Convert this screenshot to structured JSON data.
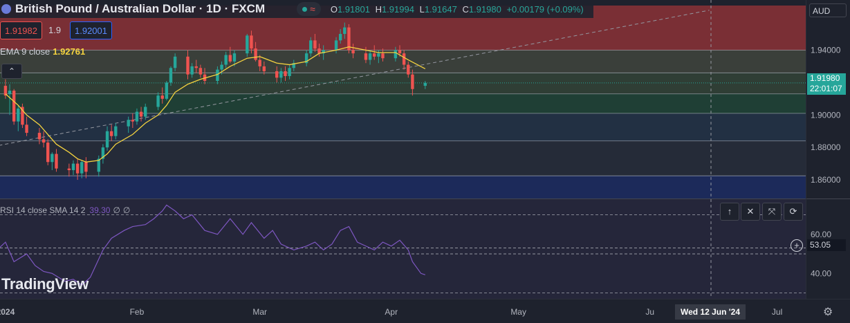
{
  "header": {
    "title": "British Pound / Australian Dollar · 1D · FXCM",
    "ohlc": [
      {
        "label": "O",
        "value": "1.91801"
      },
      {
        "label": "H",
        "value": "1.91994"
      },
      {
        "label": "L",
        "value": "1.91647"
      },
      {
        "label": "C",
        "value": "1.91980"
      },
      {
        "label": "",
        "value": "+0.00179 (+0.09%)"
      }
    ],
    "wave_icon": "≈"
  },
  "trade": {
    "sell": "1.91982",
    "spread": "1.9",
    "buy": "1.92001"
  },
  "ema": {
    "label": "EMA 9 close",
    "value": "1.92761"
  },
  "collapse_icon": "⌃",
  "rsi": {
    "label": "RSI 14 close SMA 14 2",
    "value": "39.30",
    "extra1": "∅",
    "extra2": "∅"
  },
  "pane_buttons": [
    "↑",
    "✕",
    "⤧",
    "⟳"
  ],
  "logo": "TradingView",
  "axis": {
    "currency": "AUD",
    "price_label": "1.91980",
    "countdown": "22:01:07",
    "rsi_label": "53.05",
    "crosshair_date": "Wed 12 Jun '24"
  },
  "colors": {
    "up": "#26a69a",
    "down": "#ef5350",
    "ema": "#f5d33f",
    "rsi": "#7e57c2",
    "bg": "#1e222d"
  },
  "chart_data": {
    "type": "candlestick",
    "title": "British Pound / Australian Dollar · 1D · FXCM",
    "y_ticks": [
      "1.86000",
      "1.88000",
      "1.90000",
      "1.94000"
    ],
    "y_tick_values": [
      1.86,
      1.88,
      1.9,
      1.94
    ],
    "ylim": [
      1.8485,
      1.9675
    ],
    "x_ticks": [
      "2024",
      "Feb",
      "Mar",
      "Apr",
      "May",
      "Ju",
      "Jul"
    ],
    "x_tick_days": [
      0,
      31,
      60,
      91,
      121,
      152,
      182
    ],
    "zones": [
      {
        "from": 1.94,
        "to": 1.9675,
        "color": "#7a2f35"
      },
      {
        "from": 1.926,
        "to": 1.94,
        "color": "#3a3f3a"
      },
      {
        "from": 1.913,
        "to": 1.926,
        "color": "#2f3e35"
      },
      {
        "from": 1.901,
        "to": 1.913,
        "color": "#1f3f35"
      },
      {
        "from": 1.884,
        "to": 1.901,
        "color": "#223043"
      },
      {
        "from": 1.8625,
        "to": 1.884,
        "color": "#252b38"
      },
      {
        "from": 1.8485,
        "to": 1.8625,
        "color": "#1c2a5a"
      }
    ],
    "levels": [
      1.94,
      1.926,
      1.913,
      1.901,
      1.884,
      1.8625
    ],
    "current_price": 1.9198,
    "trendline": {
      "start": [
        -3,
        1.8805
      ],
      "end": [
        166,
        1.9646
      ]
    },
    "candles": [
      {
        "d": -2,
        "o": 1.915,
        "h": 1.92,
        "l": 1.908,
        "c": 1.918
      },
      {
        "d": 0,
        "o": 1.918,
        "h": 1.922,
        "l": 1.91,
        "c": 1.912
      },
      {
        "d": 1,
        "o": 1.913,
        "h": 1.919,
        "l": 1.9,
        "c": 1.915
      },
      {
        "d": 2,
        "o": 1.915,
        "h": 1.916,
        "l": 1.894,
        "c": 1.896
      },
      {
        "d": 3,
        "o": 1.896,
        "h": 1.906,
        "l": 1.89,
        "c": 1.904
      },
      {
        "d": 4,
        "o": 1.905,
        "h": 1.907,
        "l": 1.892,
        "c": 1.894
      },
      {
        "d": 5,
        "o": 1.894,
        "h": 1.899,
        "l": 1.887,
        "c": 1.889
      },
      {
        "d": 8,
        "o": 1.889,
        "h": 1.892,
        "l": 1.882,
        "c": 1.885
      },
      {
        "d": 9,
        "o": 1.885,
        "h": 1.89,
        "l": 1.88,
        "c": 1.883
      },
      {
        "d": 10,
        "o": 1.883,
        "h": 1.885,
        "l": 1.869,
        "c": 1.871
      },
      {
        "d": 11,
        "o": 1.871,
        "h": 1.877,
        "l": 1.866,
        "c": 1.876
      },
      {
        "d": 12,
        "o": 1.876,
        "h": 1.879,
        "l": 1.865,
        "c": 1.867
      },
      {
        "d": 15,
        "o": 1.867,
        "h": 1.87,
        "l": 1.862,
        "c": 1.866
      },
      {
        "d": 16,
        "o": 1.866,
        "h": 1.872,
        "l": 1.863,
        "c": 1.87
      },
      {
        "d": 17,
        "o": 1.87,
        "h": 1.873,
        "l": 1.86,
        "c": 1.864
      },
      {
        "d": 18,
        "o": 1.864,
        "h": 1.872,
        "l": 1.861,
        "c": 1.871
      },
      {
        "d": 19,
        "o": 1.871,
        "h": 1.874,
        "l": 1.861,
        "c": 1.865
      },
      {
        "d": 22,
        "o": 1.865,
        "h": 1.875,
        "l": 1.862,
        "c": 1.873
      },
      {
        "d": 23,
        "o": 1.873,
        "h": 1.882,
        "l": 1.87,
        "c": 1.88
      },
      {
        "d": 24,
        "o": 1.88,
        "h": 1.893,
        "l": 1.878,
        "c": 1.89
      },
      {
        "d": 25,
        "o": 1.89,
        "h": 1.894,
        "l": 1.884,
        "c": 1.887
      },
      {
        "d": 26,
        "o": 1.887,
        "h": 1.895,
        "l": 1.885,
        "c": 1.893
      },
      {
        "d": 29,
        "o": 1.893,
        "h": 1.899,
        "l": 1.889,
        "c": 1.897
      },
      {
        "d": 30,
        "o": 1.897,
        "h": 1.901,
        "l": 1.892,
        "c": 1.896
      },
      {
        "d": 31,
        "o": 1.896,
        "h": 1.904,
        "l": 1.894,
        "c": 1.902
      },
      {
        "d": 32,
        "o": 1.902,
        "h": 1.905,
        "l": 1.896,
        "c": 1.899
      },
      {
        "d": 33,
        "o": 1.899,
        "h": 1.907,
        "l": 1.897,
        "c": 1.905
      },
      {
        "d": 36,
        "o": 1.905,
        "h": 1.914,
        "l": 1.903,
        "c": 1.912
      },
      {
        "d": 37,
        "o": 1.912,
        "h": 1.917,
        "l": 1.907,
        "c": 1.91
      },
      {
        "d": 38,
        "o": 1.91,
        "h": 1.921,
        "l": 1.909,
        "c": 1.92
      },
      {
        "d": 39,
        "o": 1.92,
        "h": 1.93,
        "l": 1.918,
        "c": 1.929
      },
      {
        "d": 40,
        "o": 1.929,
        "h": 1.938,
        "l": 1.927,
        "c": 1.936
      },
      {
        "d": 43,
        "o": 1.936,
        "h": 1.94,
        "l": 1.922,
        "c": 1.925
      },
      {
        "d": 44,
        "o": 1.925,
        "h": 1.932,
        "l": 1.923,
        "c": 1.93
      },
      {
        "d": 45,
        "o": 1.93,
        "h": 1.934,
        "l": 1.926,
        "c": 1.929
      },
      {
        "d": 46,
        "o": 1.929,
        "h": 1.931,
        "l": 1.923,
        "c": 1.925
      },
      {
        "d": 47,
        "o": 1.925,
        "h": 1.929,
        "l": 1.919,
        "c": 1.921
      },
      {
        "d": 50,
        "o": 1.921,
        "h": 1.93,
        "l": 1.919,
        "c": 1.928
      },
      {
        "d": 51,
        "o": 1.928,
        "h": 1.933,
        "l": 1.925,
        "c": 1.931
      },
      {
        "d": 52,
        "o": 1.931,
        "h": 1.939,
        "l": 1.929,
        "c": 1.937
      },
      {
        "d": 53,
        "o": 1.937,
        "h": 1.942,
        "l": 1.932,
        "c": 1.933
      },
      {
        "d": 54,
        "o": 1.933,
        "h": 1.94,
        "l": 1.93,
        "c": 1.938
      },
      {
        "d": 57,
        "o": 1.938,
        "h": 1.95,
        "l": 1.936,
        "c": 1.949
      },
      {
        "d": 58,
        "o": 1.949,
        "h": 1.952,
        "l": 1.938,
        "c": 1.941
      },
      {
        "d": 59,
        "o": 1.941,
        "h": 1.945,
        "l": 1.933,
        "c": 1.934
      },
      {
        "d": 60,
        "o": 1.934,
        "h": 1.937,
        "l": 1.927,
        "c": 1.93
      },
      {
        "d": 61,
        "o": 1.93,
        "h": 1.933,
        "l": 1.925,
        "c": 1.927
      },
      {
        "d": 64,
        "o": 1.927,
        "h": 1.93,
        "l": 1.92,
        "c": 1.923
      },
      {
        "d": 65,
        "o": 1.923,
        "h": 1.929,
        "l": 1.92,
        "c": 1.927
      },
      {
        "d": 66,
        "o": 1.927,
        "h": 1.93,
        "l": 1.921,
        "c": 1.924
      },
      {
        "d": 67,
        "o": 1.924,
        "h": 1.931,
        "l": 1.922,
        "c": 1.929
      },
      {
        "d": 68,
        "o": 1.929,
        "h": 1.934,
        "l": 1.927,
        "c": 1.932
      },
      {
        "d": 71,
        "o": 1.932,
        "h": 1.94,
        "l": 1.93,
        "c": 1.938
      },
      {
        "d": 72,
        "o": 1.938,
        "h": 1.948,
        "l": 1.936,
        "c": 1.946
      },
      {
        "d": 73,
        "o": 1.946,
        "h": 1.95,
        "l": 1.939,
        "c": 1.941
      },
      {
        "d": 74,
        "o": 1.941,
        "h": 1.944,
        "l": 1.936,
        "c": 1.938
      },
      {
        "d": 75,
        "o": 1.938,
        "h": 1.943,
        "l": 1.934,
        "c": 1.94
      },
      {
        "d": 78,
        "o": 1.94,
        "h": 1.948,
        "l": 1.938,
        "c": 1.946
      },
      {
        "d": 79,
        "o": 1.946,
        "h": 1.953,
        "l": 1.944,
        "c": 1.95
      },
      {
        "d": 80,
        "o": 1.95,
        "h": 1.957,
        "l": 1.947,
        "c": 1.954
      },
      {
        "d": 81,
        "o": 1.954,
        "h": 1.956,
        "l": 1.938,
        "c": 1.94
      },
      {
        "d": 82,
        "o": 1.94,
        "h": 1.944,
        "l": 1.935,
        "c": 1.938
      },
      {
        "d": 85,
        "o": 1.938,
        "h": 1.942,
        "l": 1.932,
        "c": 1.934
      },
      {
        "d": 86,
        "o": 1.934,
        "h": 1.94,
        "l": 1.931,
        "c": 1.938
      },
      {
        "d": 87,
        "o": 1.938,
        "h": 1.943,
        "l": 1.934,
        "c": 1.936
      },
      {
        "d": 88,
        "o": 1.936,
        "h": 1.94,
        "l": 1.932,
        "c": 1.938
      },
      {
        "d": 89,
        "o": 1.938,
        "h": 1.941,
        "l": 1.933,
        "c": 1.935
      },
      {
        "d": 92,
        "o": 1.935,
        "h": 1.942,
        "l": 1.933,
        "c": 1.94
      },
      {
        "d": 93,
        "o": 1.94,
        "h": 1.943,
        "l": 1.936,
        "c": 1.938
      },
      {
        "d": 94,
        "o": 1.938,
        "h": 1.94,
        "l": 1.928,
        "c": 1.931
      },
      {
        "d": 95,
        "o": 1.931,
        "h": 1.933,
        "l": 1.923,
        "c": 1.925
      },
      {
        "d": 96,
        "o": 1.925,
        "h": 1.928,
        "l": 1.912,
        "c": 1.916
      },
      {
        "d": 99,
        "o": 1.918,
        "h": 1.921,
        "l": 1.916,
        "c": 1.9198
      }
    ],
    "ema_series": [
      {
        "d": 0,
        "v": 1.913
      },
      {
        "d": 3,
        "v": 1.906
      },
      {
        "d": 5,
        "v": 1.9
      },
      {
        "d": 8,
        "v": 1.894
      },
      {
        "d": 10,
        "v": 1.888
      },
      {
        "d": 12,
        "v": 1.882
      },
      {
        "d": 15,
        "v": 1.877
      },
      {
        "d": 17,
        "v": 1.873
      },
      {
        "d": 19,
        "v": 1.871
      },
      {
        "d": 22,
        "v": 1.872
      },
      {
        "d": 24,
        "v": 1.876
      },
      {
        "d": 26,
        "v": 1.882
      },
      {
        "d": 30,
        "v": 1.888
      },
      {
        "d": 33,
        "v": 1.895
      },
      {
        "d": 36,
        "v": 1.9
      },
      {
        "d": 38,
        "v": 1.906
      },
      {
        "d": 40,
        "v": 1.914
      },
      {
        "d": 43,
        "v": 1.919
      },
      {
        "d": 46,
        "v": 1.922
      },
      {
        "d": 50,
        "v": 1.925
      },
      {
        "d": 53,
        "v": 1.93
      },
      {
        "d": 57,
        "v": 1.935
      },
      {
        "d": 60,
        "v": 1.936
      },
      {
        "d": 64,
        "v": 1.932
      },
      {
        "d": 67,
        "v": 1.931
      },
      {
        "d": 71,
        "v": 1.933
      },
      {
        "d": 74,
        "v": 1.938
      },
      {
        "d": 78,
        "v": 1.94
      },
      {
        "d": 81,
        "v": 1.942
      },
      {
        "d": 85,
        "v": 1.94
      },
      {
        "d": 88,
        "v": 1.9385
      },
      {
        "d": 92,
        "v": 1.9385
      },
      {
        "d": 95,
        "v": 1.934
      },
      {
        "d": 99,
        "v": 1.9285
      }
    ],
    "rsi_ticks": [
      "60.00",
      "40.00"
    ],
    "rsi_tick_values": [
      60,
      40
    ],
    "rsi_ylim": [
      27,
      78
    ],
    "rsi_levels": [
      70,
      53.05,
      50,
      30
    ],
    "rsi_series": [
      {
        "d": -3,
        "v": 50
      },
      {
        "d": 0,
        "v": 56
      },
      {
        "d": 2,
        "v": 46
      },
      {
        "d": 5,
        "v": 50
      },
      {
        "d": 7,
        "v": 44
      },
      {
        "d": 9,
        "v": 41
      },
      {
        "d": 11,
        "v": 40
      },
      {
        "d": 14,
        "v": 36
      },
      {
        "d": 16,
        "v": 37
      },
      {
        "d": 18,
        "v": 34
      },
      {
        "d": 20,
        "v": 38
      },
      {
        "d": 23,
        "v": 52
      },
      {
        "d": 25,
        "v": 58
      },
      {
        "d": 28,
        "v": 62
      },
      {
        "d": 30,
        "v": 64
      },
      {
        "d": 33,
        "v": 65
      },
      {
        "d": 35,
        "v": 68
      },
      {
        "d": 37,
        "v": 72
      },
      {
        "d": 38,
        "v": 75
      },
      {
        "d": 40,
        "v": 72
      },
      {
        "d": 42,
        "v": 68
      },
      {
        "d": 44,
        "v": 70
      },
      {
        "d": 47,
        "v": 62
      },
      {
        "d": 50,
        "v": 60
      },
      {
        "d": 53,
        "v": 68
      },
      {
        "d": 56,
        "v": 60
      },
      {
        "d": 58,
        "v": 66
      },
      {
        "d": 61,
        "v": 58
      },
      {
        "d": 63,
        "v": 62
      },
      {
        "d": 65,
        "v": 55
      },
      {
        "d": 68,
        "v": 52
      },
      {
        "d": 71,
        "v": 54
      },
      {
        "d": 73,
        "v": 56
      },
      {
        "d": 75,
        "v": 52
      },
      {
        "d": 77,
        "v": 55
      },
      {
        "d": 79,
        "v": 62
      },
      {
        "d": 81,
        "v": 64
      },
      {
        "d": 83,
        "v": 56
      },
      {
        "d": 85,
        "v": 54
      },
      {
        "d": 87,
        "v": 52
      },
      {
        "d": 89,
        "v": 56
      },
      {
        "d": 91,
        "v": 54
      },
      {
        "d": 93,
        "v": 57
      },
      {
        "d": 95,
        "v": 52
      },
      {
        "d": 96,
        "v": 46
      },
      {
        "d": 98,
        "v": 40
      },
      {
        "d": 99,
        "v": 39.3
      }
    ]
  }
}
